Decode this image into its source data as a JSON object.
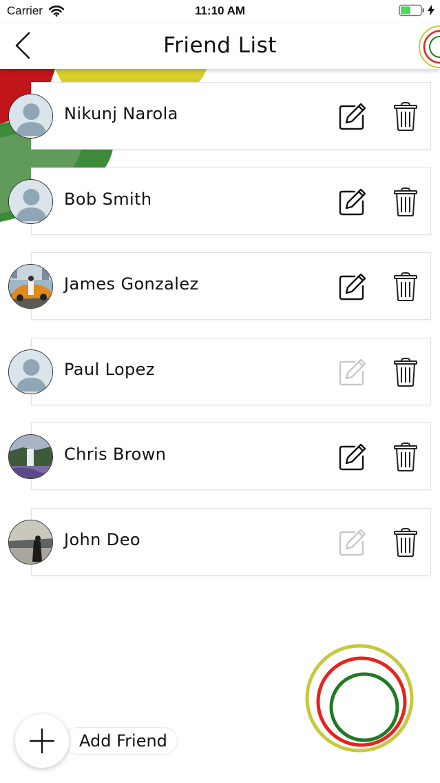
{
  "status_bar": {
    "carrier": "Carrier",
    "time": "11:10 AM"
  },
  "header": {
    "title": "Friend List"
  },
  "friends": [
    {
      "name": "Nikunj Narola",
      "avatar": "placeholder",
      "edit_enabled": true
    },
    {
      "name": "Bob Smith",
      "avatar": "placeholder",
      "edit_enabled": true
    },
    {
      "name": "James Gonzalez",
      "avatar": "photo-car",
      "edit_enabled": true
    },
    {
      "name": "Paul Lopez",
      "avatar": "placeholder",
      "edit_enabled": false
    },
    {
      "name": "Chris Brown",
      "avatar": "photo-waterfall",
      "edit_enabled": true
    },
    {
      "name": "John Deo",
      "avatar": "photo-beach",
      "edit_enabled": false
    }
  ],
  "add_friend": {
    "label": "Add Friend"
  },
  "icons": {
    "back": "chevron-left-icon",
    "edit": "edit-pencil-icon",
    "delete": "trash-icon",
    "add": "plus-icon"
  },
  "colors": {
    "ring_olive": "#c5c93a",
    "ring_red": "#e8231c",
    "ring_green": "#1f7a22",
    "deco_red": "#c0151a",
    "deco_yellow": "#d9cf2b",
    "deco_green": "#3c8a3a",
    "edit_disabled": "#c8c8c8"
  }
}
